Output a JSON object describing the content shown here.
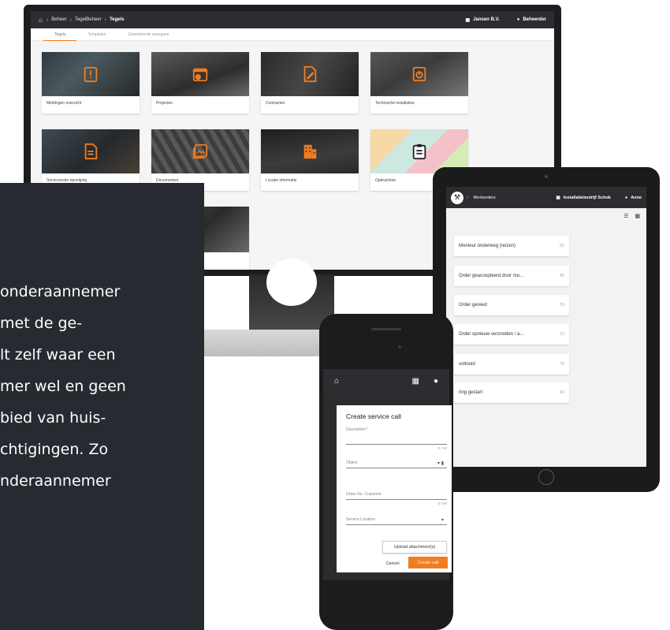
{
  "monitor": {
    "breadcrumb": [
      "Beheer",
      "TegelBeheer",
      "Tegels"
    ],
    "company": "Jansen B.V.",
    "user": "Beheerder",
    "tabs": [
      "Tegels",
      "Templates",
      "Gerelateerde weergave"
    ],
    "tiles": [
      {
        "label": "Meldingen overzicht",
        "icon": "alert-clipboard-icon"
      },
      {
        "label": "Projecten",
        "icon": "project-calendar-icon"
      },
      {
        "label": "Contracten",
        "icon": "contract-pen-icon"
      },
      {
        "label": "Technische installaties",
        "icon": "install-device-icon"
      },
      {
        "label": "Serviceorder opvolging",
        "icon": "document-icon"
      },
      {
        "label": "Documenten",
        "icon": "image-document-icon"
      },
      {
        "label": "Locatie informatie",
        "icon": "building-icon"
      },
      {
        "label": "Opdrachten",
        "icon": "clipboard-list-icon"
      }
    ]
  },
  "text_panel": {
    "lines": [
      "onderaannemer",
      "met de ge-",
      "lt zelf waar een",
      "mer wel en geen",
      "bied van huis-",
      "chtigingen. Zo",
      "nderaannemer"
    ]
  },
  "tablet": {
    "title": "Werkorders",
    "company": "Installatiebedrijf Schok",
    "user": "Anne",
    "orders": [
      {
        "label": "Monteur onderweg (reizen)",
        "count": "50"
      },
      {
        "label": "Order geaccepteerd door mo...",
        "count": "40"
      },
      {
        "label": "Order gereed",
        "count": "70"
      },
      {
        "label": "Order opnieuw verzonden / a...",
        "count": "23"
      },
      {
        "label": "voltooid",
        "count": "75"
      },
      {
        "label": "ring gestart",
        "count": "60"
      }
    ]
  },
  "phone": {
    "dialog_title": "Create service call",
    "description_label": "Description *",
    "description_count": "0 / 50",
    "object_label": "Object",
    "order_no_label": "Order No. Customer",
    "order_no_count": "0 / 50",
    "service_location_label": "Service Location",
    "upload_label": "Upload attachment(s)",
    "cancel_label": "Cancel",
    "create_label": "Create call"
  },
  "colors": {
    "accent": "#ef7d22",
    "topbar": "#2b2d31",
    "panel": "#272a30"
  }
}
